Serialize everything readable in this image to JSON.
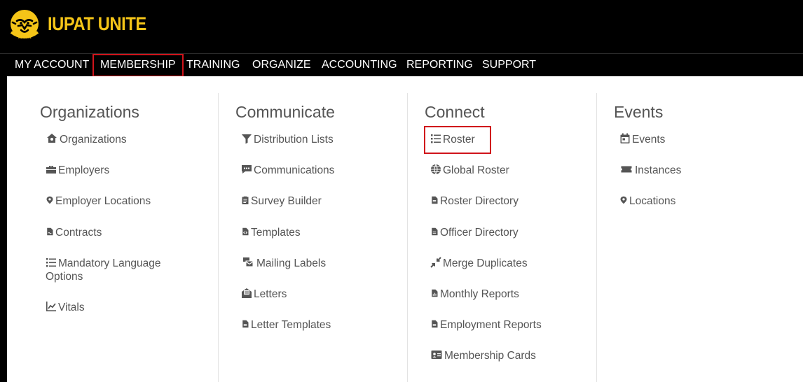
{
  "brand": {
    "name": "IUPAT UNITE",
    "sub": "IUPAT",
    "color": "#f5c518"
  },
  "nav": {
    "items": [
      {
        "label": "MY ACCOUNT"
      },
      {
        "label": "MEMBERSHIP",
        "active": true
      },
      {
        "label": "TRAINING"
      },
      {
        "label": "ORGANIZE"
      },
      {
        "label": "ACCOUNTING"
      },
      {
        "label": "REPORTING"
      },
      {
        "label": "SUPPORT"
      }
    ]
  },
  "columns": [
    {
      "title": "Organizations",
      "items": [
        {
          "label": "Organizations",
          "icon": "home-icon"
        },
        {
          "label": "Employers",
          "icon": "briefcase-icon"
        },
        {
          "label": "Employer Locations",
          "icon": "map-marker-icon"
        },
        {
          "label": "Contracts",
          "icon": "file-contract-icon"
        },
        {
          "label": "Mandatory Language Options",
          "icon": "list-icon"
        },
        {
          "label": "Vitals",
          "icon": "line-chart-icon"
        }
      ]
    },
    {
      "title": "Communicate",
      "items": [
        {
          "label": "Distribution Lists",
          "icon": "filter-icon"
        },
        {
          "label": "Communications",
          "icon": "comment-dots-icon"
        },
        {
          "label": "Survey Builder",
          "icon": "clipboard-icon"
        },
        {
          "label": "Templates",
          "icon": "file-code-icon"
        },
        {
          "label": "Mailing Labels",
          "icon": "mail-bulk-icon"
        },
        {
          "label": "Letters",
          "icon": "envelope-open-icon"
        },
        {
          "label": "Letter Templates",
          "icon": "file-icon"
        }
      ]
    },
    {
      "title": "Connect",
      "items": [
        {
          "label": "Roster",
          "icon": "list-icon",
          "highlighted": true
        },
        {
          "label": "Global Roster",
          "icon": "globe-icon"
        },
        {
          "label": "Roster Directory",
          "icon": "file-icon"
        },
        {
          "label": "Officer Directory",
          "icon": "file-icon"
        },
        {
          "label": "Merge Duplicates",
          "icon": "compress-icon"
        },
        {
          "label": "Monthly Reports",
          "icon": "file-chart-icon"
        },
        {
          "label": "Employment Reports",
          "icon": "file-icon"
        },
        {
          "label": "Membership Cards",
          "icon": "id-card-icon"
        }
      ]
    },
    {
      "title": "Events",
      "items": [
        {
          "label": "Events",
          "icon": "calendar-icon"
        },
        {
          "label": "Instances",
          "icon": "ticket-icon"
        },
        {
          "label": "Locations",
          "icon": "map-marker-icon"
        }
      ]
    }
  ]
}
